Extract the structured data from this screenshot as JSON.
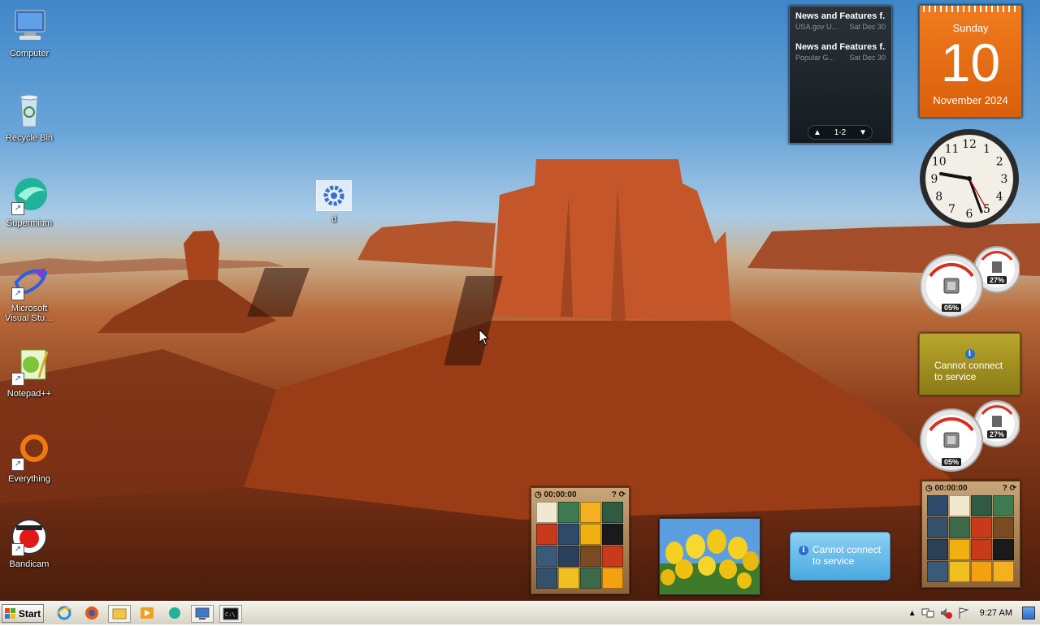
{
  "desktop_icons": [
    {
      "label": "Computer",
      "icon": "computer-icon"
    },
    {
      "label": "Recycle Bin",
      "icon": "recycle-bin-icon"
    },
    {
      "label": "Supermium",
      "icon": "supermium-icon"
    },
    {
      "label": "Microsoft Visual Stu…",
      "icon": "visual-studio-icon"
    },
    {
      "label": "Notepad++",
      "icon": "notepad-plus-plus-icon"
    },
    {
      "label": "Everything",
      "icon": "everything-icon"
    },
    {
      "label": "Bandicam",
      "icon": "bandicam-icon"
    }
  ],
  "floating_icon": {
    "label": "d",
    "icon": "settings-gear-icon"
  },
  "news_gadget": {
    "items": [
      {
        "title": "News and Features f...",
        "source": "USA.gov U...",
        "date": "Sat Dec 30"
      },
      {
        "title": "News and Features f...",
        "source": "Popular G...",
        "date": "Sat Dec 30"
      }
    ],
    "page": "1-2"
  },
  "calendar": {
    "weekday": "Sunday",
    "day": "10",
    "month_year": "November 2024"
  },
  "clock": {
    "hour_marks": [
      "12",
      "1",
      "2",
      "3",
      "4",
      "5",
      "6",
      "7",
      "8",
      "9",
      "10",
      "11"
    ]
  },
  "cpu_meters": [
    {
      "cpu": "05%",
      "memory": "27%"
    },
    {
      "cpu": "05%",
      "memory": "27%"
    }
  ],
  "weather_gadgets": [
    {
      "line1": "Cannot connect",
      "line2": "to service"
    },
    {
      "line1": "Cannot connect",
      "line2": "to service"
    }
  ],
  "puzzles": [
    {
      "timer": "00:00:00"
    },
    {
      "timer": "00:00:00"
    }
  ],
  "taskbar": {
    "start_label": "Start",
    "apps": [
      "internet-explorer-icon",
      "firefox-icon",
      "file-explorer-icon",
      "media-player-icon",
      "supermium-icon",
      "remote-desktop-icon",
      "command-prompt-icon"
    ],
    "clock": "9:27 AM"
  },
  "colors": {
    "calendar_orange": "#e96e14",
    "news_bg": "#1f262d",
    "weather_gold": "#a89422",
    "weather_blue": "#5bb4e6"
  }
}
